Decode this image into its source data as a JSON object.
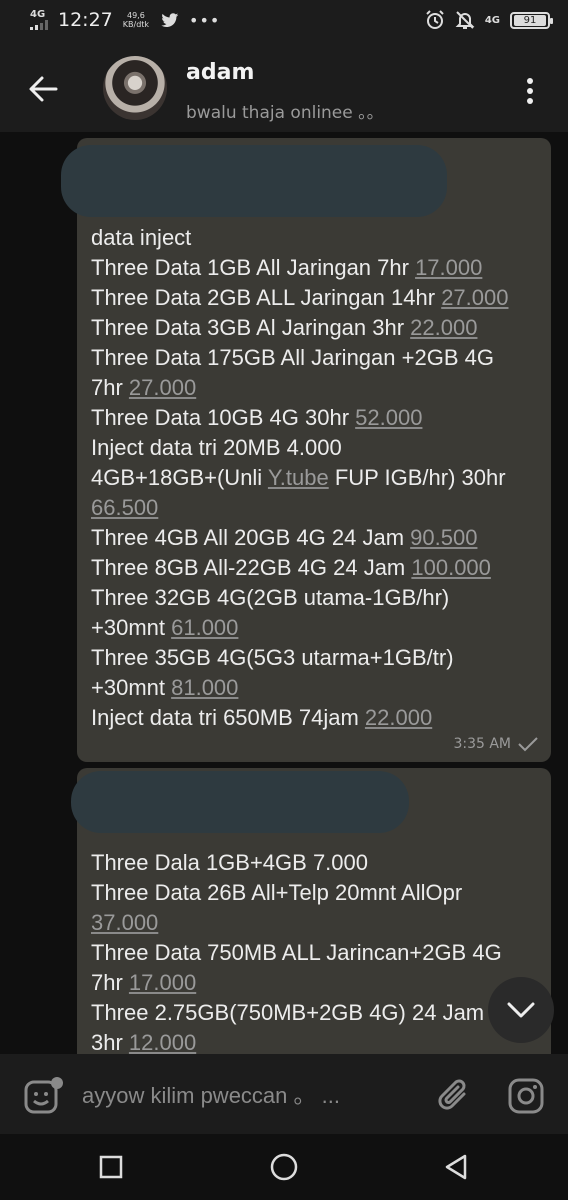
{
  "status_bar": {
    "network_left": "4G",
    "time": "12:27",
    "speed_value": "49,6",
    "speed_unit": "KB/dtk",
    "more": "•••",
    "network_right": "4G",
    "battery": "91"
  },
  "header": {
    "name": "adam",
    "status": "bwalu thaja onlinee 。。"
  },
  "messages": [
    {
      "lines": [
        {
          "text": "data inject",
          "price": ""
        },
        {
          "text": "Three Data 1GB All Jaringan 7hr ",
          "price": "17.000"
        },
        {
          "text": "Three Data 2GB ALL Jaringan 14hr ",
          "price": "27.000"
        },
        {
          "text": "Three Data 3GB Al Jaringan 3hr ",
          "price": "22.000"
        },
        {
          "text": "Three Data 175GB All Jaringan +2GB 4G",
          "price": ""
        },
        {
          "text": "7hr ",
          "price": "27.000"
        },
        {
          "text": "Three Data 10GB 4G 30hr ",
          "price": "52.000"
        },
        {
          "text": "Inject data tri 20MB 4.000",
          "price": ""
        },
        {
          "text": "4GB+18GB+(Unli ",
          "link": "Y.tube",
          "after": " FUP IGB/hr) 30hr"
        },
        {
          "text": "",
          "price": "66.500"
        },
        {
          "text": "Three 4GB All 20GB 4G 24 Jam ",
          "price": "90.500"
        },
        {
          "text": "Three 8GB All-22GB 4G 24 Jam ",
          "price": "100.000"
        },
        {
          "text": "Three 32GB 4G(2GB utama-1GB/hr)",
          "price": ""
        },
        {
          "text": "+30mnt ",
          "price": "61.000"
        },
        {
          "text": "Three 35GB 4G(5G3 utarma+1GB/tr)",
          "price": ""
        },
        {
          "text": "+30mnt ",
          "price": "81.000"
        },
        {
          "text": "Inject data tri 650MB 74jam ",
          "price": "22.000"
        }
      ],
      "time": "3:35 AM"
    },
    {
      "lines": [
        {
          "text": "Three Dala 1GB+4GB 7.000",
          "price": ""
        },
        {
          "text": "Three Data 26B All+Telp 20mnt AllOpr",
          "price": ""
        },
        {
          "text": "",
          "price": "37.000"
        },
        {
          "text": "Three Data 750MB ALL Jarincan+2GB 4G",
          "price": ""
        },
        {
          "text": "7hr ",
          "price": "17.000"
        },
        {
          "text": "Three 2.75GB(750MB+2GB 4G) 24 Jam",
          "price": ""
        },
        {
          "text": "3hr ",
          "price": "12.000"
        }
      ]
    }
  ],
  "input": {
    "placeholder": "ayyow kilim pweccan 。 ..."
  },
  "colors": {
    "bubble": "#3b3a35",
    "redaction": "#2e3a40",
    "price": "#9a9a9a"
  },
  "icons": [
    "back-arrow-icon",
    "more-vert-icon",
    "chevron-down-icon",
    "emoji-icon",
    "paperclip-icon",
    "camera-icon",
    "nav-recents-icon",
    "nav-home-icon",
    "nav-back-icon"
  ]
}
